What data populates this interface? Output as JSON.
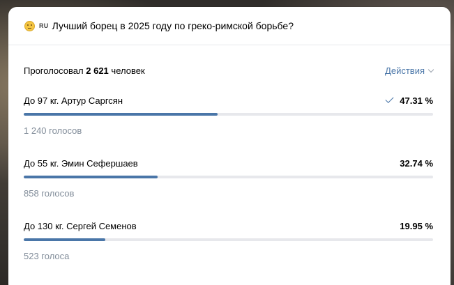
{
  "poll": {
    "emoji_icon": "thinking-face-icon",
    "lang_badge": "RU",
    "question": "Лучший борец в 2025 году по греко-римской борьбе?",
    "voted_prefix": "Проголосовал",
    "voted_count": "2 621",
    "voted_suffix": "человек",
    "actions_label": "Действия",
    "accent_color": "#4a76a8",
    "options": [
      {
        "label": "До 97 кг. Артур Саргсян",
        "percent_text": "47.31 %",
        "percent": 47.31,
        "votes": "1 240 голосов",
        "selected": true
      },
      {
        "label": "До 55 кг. Эмин Сефершаев",
        "percent_text": "32.74 %",
        "percent": 32.74,
        "votes": "858 голосов",
        "selected": false
      },
      {
        "label": "До 130 кг. Сергей Семенов",
        "percent_text": "19.95 %",
        "percent": 19.95,
        "votes": "523 голоса",
        "selected": false
      }
    ]
  }
}
